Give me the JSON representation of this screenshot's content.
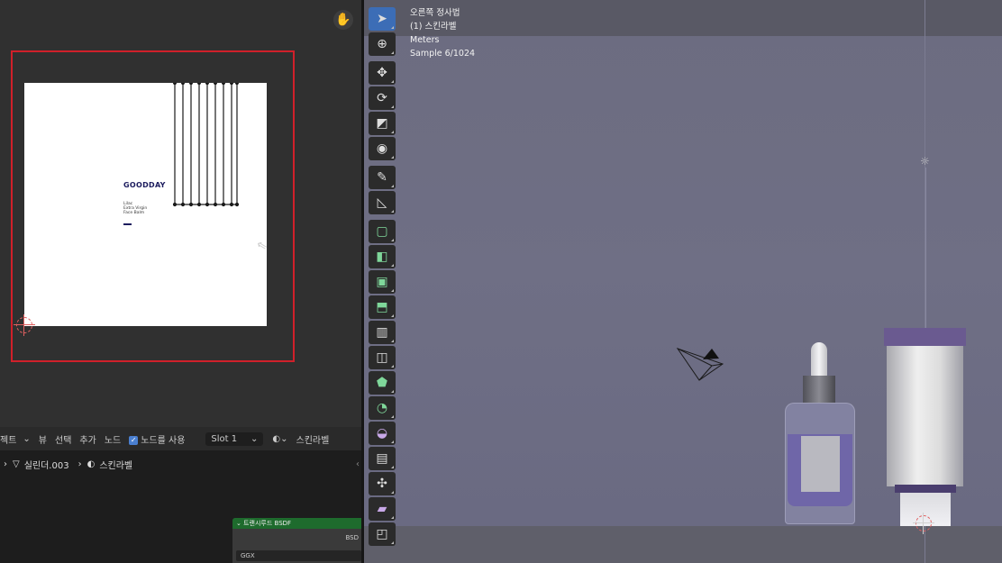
{
  "image_editor": {
    "hand_tool": "hand-icon",
    "uv_texture": {
      "brand": "GOODDAY",
      "description_lines": [
        "Lilac",
        "Extra Virgin",
        "Face Balm"
      ]
    }
  },
  "shader_editor": {
    "header": {
      "object_menu": "젝트",
      "view_menu": "뷰",
      "select_menu": "선택",
      "add_menu": "추가",
      "node_menu": "노드",
      "use_nodes_label": "노드를 사용",
      "use_nodes_checked": true,
      "slot_label": "Slot 1",
      "material_name": "스킨라벨"
    },
    "breadcrumb": {
      "object": "실린더.003",
      "material": "스킨라벨"
    },
    "node": {
      "title": "트랜시루드 BSDF",
      "output_socket": "BSD",
      "distribution": "GGX"
    }
  },
  "viewport": {
    "overlay_lines": [
      "오른쪽 정사법",
      "(1) 스킨라벨",
      "Meters",
      "Sample 6/1024"
    ],
    "tools": [
      {
        "name": "select-box",
        "icon": "cursor-arrow-icon",
        "active": true
      },
      {
        "name": "cursor",
        "icon": "cursor-3d-icon",
        "active": false
      },
      {
        "name": "move",
        "icon": "move-icon",
        "active": false
      },
      {
        "name": "rotate",
        "icon": "rotate-icon",
        "active": false
      },
      {
        "name": "scale",
        "icon": "scale-icon",
        "active": false
      },
      {
        "name": "transform",
        "icon": "transform-icon",
        "active": false
      },
      {
        "name": "annotate",
        "icon": "annotate-icon",
        "active": false
      },
      {
        "name": "measure",
        "icon": "measure-icon",
        "active": false
      },
      {
        "name": "add-cube",
        "icon": "add-cube-icon",
        "active": false
      },
      {
        "name": "extrude",
        "icon": "extrude-icon",
        "active": false
      },
      {
        "name": "inset",
        "icon": "inset-icon",
        "active": false
      },
      {
        "name": "bevel",
        "icon": "bevel-icon",
        "active": false
      },
      {
        "name": "loop-cut",
        "icon": "loop-cut-icon",
        "active": false
      },
      {
        "name": "knife",
        "icon": "knife-icon",
        "active": false
      },
      {
        "name": "poly-build",
        "icon": "poly-build-icon",
        "active": false
      },
      {
        "name": "spin",
        "icon": "spin-icon",
        "active": false
      },
      {
        "name": "smooth",
        "icon": "smooth-icon",
        "active": false
      },
      {
        "name": "edge-slide",
        "icon": "edge-slide-icon",
        "active": false
      },
      {
        "name": "shrink-fatten",
        "icon": "shrink-fatten-icon",
        "active": false
      },
      {
        "name": "shear",
        "icon": "shear-icon",
        "active": false
      },
      {
        "name": "rip",
        "icon": "rip-icon",
        "active": false
      }
    ]
  }
}
